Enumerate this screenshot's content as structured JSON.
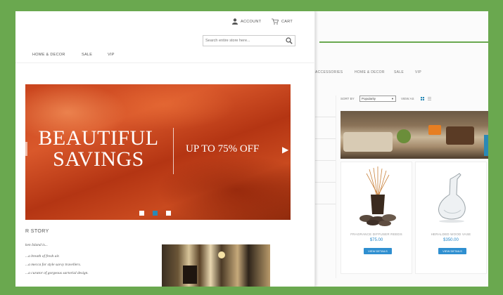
{
  "colors": {
    "frame": "#6aa84f",
    "accent": "#2a89b5",
    "button": "#2f8fd0",
    "price": "#2a89c9"
  },
  "front": {
    "header": {
      "account_label": "ACCOUNT",
      "cart_label": "CART",
      "account_icon": "user-icon",
      "cart_icon": "cart-icon"
    },
    "search": {
      "placeholder": "Search entire store here...",
      "icon": "search-icon"
    },
    "nav": {
      "items": [
        "HOME & DECOR",
        "SALE",
        "VIP"
      ]
    },
    "hero": {
      "title_line1": "BEAUTIFUL",
      "title_line2": "SAVINGS",
      "offer": "UP TO 75% OFF",
      "arrow_icon": "chevron-right-icon",
      "slides": 3,
      "active_slide": 2
    },
    "story": {
      "heading": "R STORY",
      "intro": "ken Island is...",
      "lines": [
        "...a breath of fresh air.",
        "...a mecca for style savvy travellers.",
        "...a curator of gorgeous sartorial design."
      ]
    }
  },
  "back": {
    "nav": {
      "items": [
        "ACCESSORIES",
        "HOME & DECOR",
        "SALE",
        "VIP"
      ]
    },
    "toolbar": {
      "sort_label": "SORT BY",
      "sort_value": "Popularity",
      "view_label": "VIEW AS",
      "grid_icon": "grid-icon",
      "list_icon": "list-icon"
    },
    "products": [
      {
        "name": "FRAGRANCE DIFFUSER REEDS",
        "price": "$75.00",
        "button": "VIEW DETAILS"
      },
      {
        "name": "HERALDED WOOD VASE",
        "price": "$350.00",
        "button": "VIEW DETAILS"
      }
    ]
  }
}
